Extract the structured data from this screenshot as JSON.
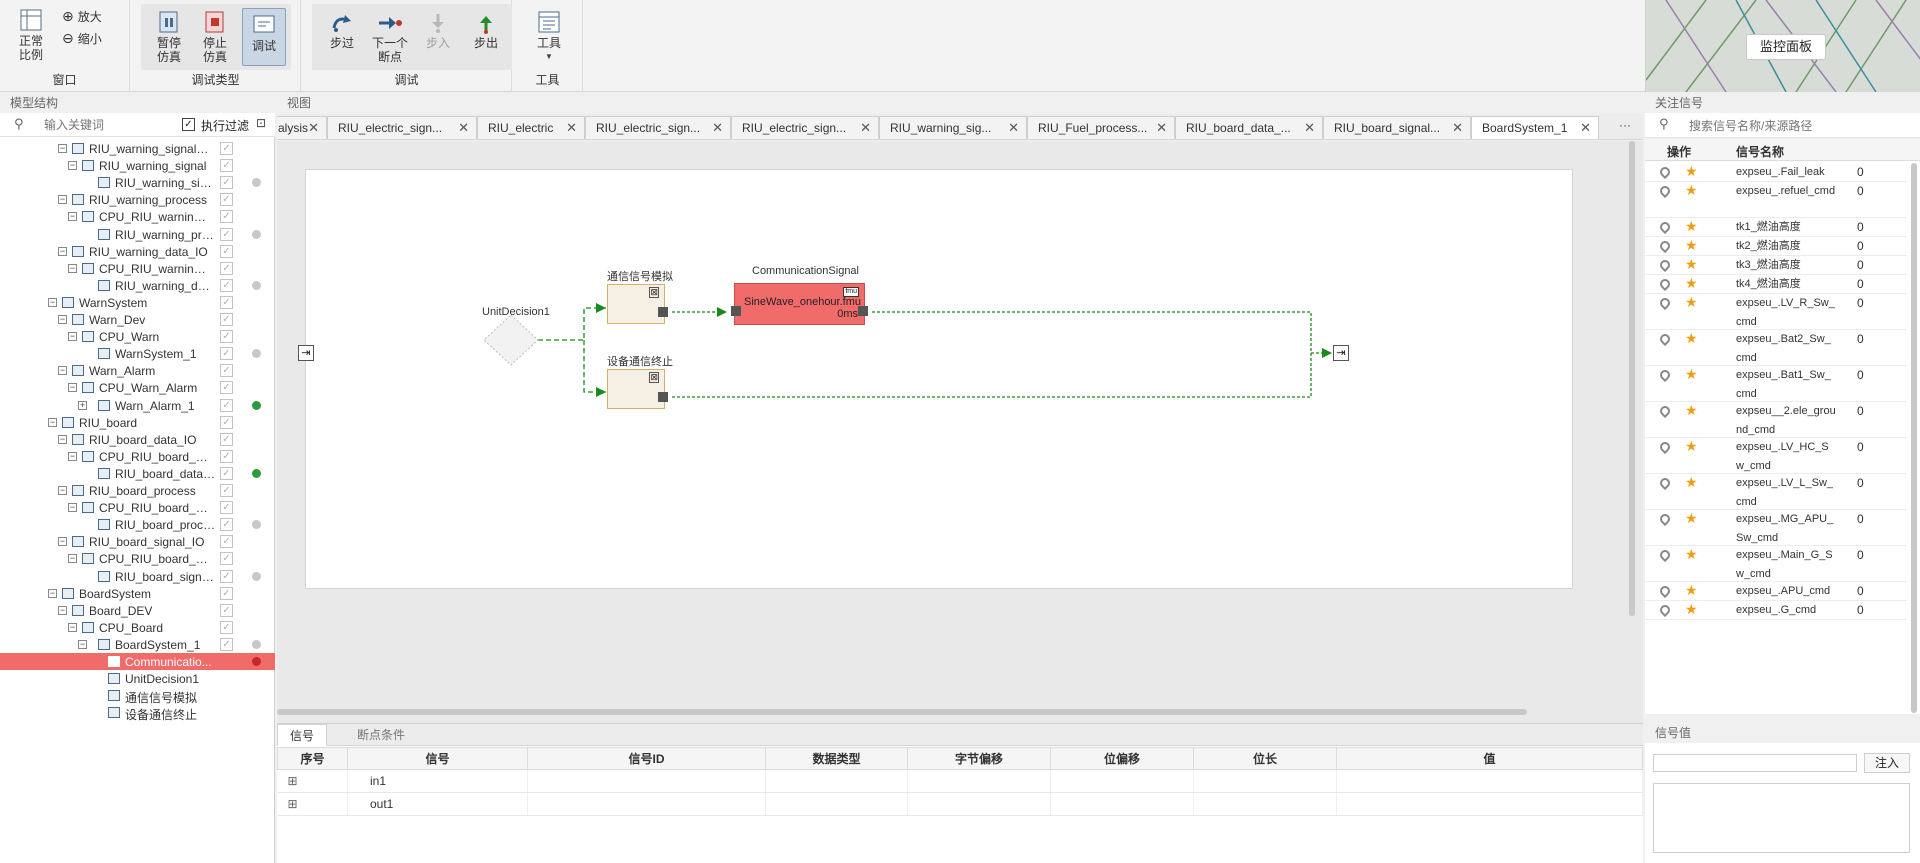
{
  "ribbon": {
    "window_group": {
      "label": "窗口",
      "normal_scale": "正常\n比例",
      "zoom_in": "放大",
      "zoom_out": "缩小"
    },
    "debug_type_group": {
      "label": "调试类型",
      "pause": "暂停\n仿真",
      "stop": "停止\n仿真",
      "debug": "调试"
    },
    "debug_group": {
      "label": "调试",
      "step_over": "步过",
      "next_breakpoint": "下一个\n断点",
      "step_into": "步入",
      "step_out": "步出"
    },
    "tools_group": {
      "label": "工具",
      "tools": "工具"
    }
  },
  "monitor": {
    "button": "监控面板"
  },
  "left_panel": {
    "title": "模型结构",
    "search_placeholder": "输入关键词",
    "filter_label": "执行过滤",
    "tree": [
      {
        "label": "RIU_warning_signal_IO",
        "level": 2,
        "expander": "⊟",
        "dot": ""
      },
      {
        "label": "RIU_warning_signal",
        "level": 3,
        "expander": "⊟",
        "dot": ""
      },
      {
        "label": "RIU_warning_sign...",
        "level": 4,
        "expander": "",
        "dot": "gray"
      },
      {
        "label": "RIU_warning_process",
        "level": 2,
        "expander": "⊟",
        "dot": ""
      },
      {
        "label": "CPU_RIU_warning_p...",
        "level": 3,
        "expander": "⊟",
        "dot": ""
      },
      {
        "label": "RIU_warning_proc...",
        "level": 4,
        "expander": "",
        "dot": "gray"
      },
      {
        "label": "RIU_warning_data_IO",
        "level": 2,
        "expander": "⊟",
        "dot": ""
      },
      {
        "label": "CPU_RIU_warning_d...",
        "level": 3,
        "expander": "⊟",
        "dot": ""
      },
      {
        "label": "RIU_warning_data...",
        "level": 4,
        "expander": "",
        "dot": "gray"
      },
      {
        "label": "WarnSystem",
        "level": 1,
        "expander": "⊟",
        "dot": ""
      },
      {
        "label": "Warn_Dev",
        "level": 2,
        "expander": "⊟",
        "dot": ""
      },
      {
        "label": "CPU_Warn",
        "level": 3,
        "expander": "⊟",
        "dot": ""
      },
      {
        "label": "WarnSystem_1",
        "level": 4,
        "expander": "",
        "dot": "gray"
      },
      {
        "label": "Warn_Alarm",
        "level": 2,
        "expander": "⊟",
        "dot": ""
      },
      {
        "label": "CPU_Warn_Alarm",
        "level": 3,
        "expander": "⊟",
        "dot": ""
      },
      {
        "label": "Warn_Alarm_1",
        "level": 4,
        "expander": "⊞",
        "dot": "green"
      },
      {
        "label": "RIU_board",
        "level": 1,
        "expander": "⊟",
        "dot": ""
      },
      {
        "label": "RIU_board_data_IO",
        "level": 2,
        "expander": "⊟",
        "dot": ""
      },
      {
        "label": "CPU_RIU_board_data",
        "level": 3,
        "expander": "⊟",
        "dot": ""
      },
      {
        "label": "RIU_board_data_I...",
        "level": 4,
        "expander": "",
        "dot": "green"
      },
      {
        "label": "RIU_board_process",
        "level": 2,
        "expander": "⊟",
        "dot": ""
      },
      {
        "label": "CPU_RIU_board_pro...",
        "level": 3,
        "expander": "⊟",
        "dot": ""
      },
      {
        "label": "RIU_board_proces...",
        "level": 4,
        "expander": "",
        "dot": "gray"
      },
      {
        "label": "RIU_board_signal_IO",
        "level": 2,
        "expander": "⊟",
        "dot": ""
      },
      {
        "label": "CPU_RIU_board_sig...",
        "level": 3,
        "expander": "⊟",
        "dot": ""
      },
      {
        "label": "RIU_board_signal...",
        "level": 4,
        "expander": "",
        "dot": "gray"
      },
      {
        "label": "BoardSystem",
        "level": 1,
        "expander": "⊟",
        "dot": ""
      },
      {
        "label": "Board_DEV",
        "level": 2,
        "expander": "⊟",
        "dot": ""
      },
      {
        "label": "CPU_Board",
        "level": 3,
        "expander": "⊟",
        "dot": ""
      },
      {
        "label": "BoardSystem_1",
        "level": 4,
        "expander": "⊟",
        "dot": "gray"
      },
      {
        "label": "Communicatio...",
        "level": 5,
        "expander": "",
        "dot": "red",
        "selected": true
      },
      {
        "label": "UnitDecision1",
        "level": 5,
        "expander": "",
        "dot": ""
      },
      {
        "label": "通信信号模拟",
        "level": 5,
        "expander": "",
        "dot": ""
      },
      {
        "label": "设备通信终止",
        "level": 5,
        "expander": "",
        "dot": ""
      }
    ]
  },
  "view": {
    "title": "视图",
    "tabs": [
      {
        "label": "alysis"
      },
      {
        "label": "RIU_electric_sign..."
      },
      {
        "label": "RIU_electric"
      },
      {
        "label": "RIU_electric_sign..."
      },
      {
        "label": "RIU_electric_sign..."
      },
      {
        "label": "RIU_warning_sig..."
      },
      {
        "label": "RIU_Fuel_process..."
      },
      {
        "label": "RIU_board_data_..."
      },
      {
        "label": "RIU_board_signal..."
      },
      {
        "label": "BoardSystem_1",
        "active": true
      }
    ],
    "more": "···",
    "diagram": {
      "decision_label": "UnitDecision1",
      "sim_label": "通信信号模拟",
      "term_label": "设备通信终止",
      "comm_label": "CommunicationSignal",
      "fmu_name": "SineWave_onehour.fmu",
      "fmu_time": "0ms",
      "fmu_badge": "fmu"
    }
  },
  "bottom": {
    "tabs": [
      "信号",
      "断点条件"
    ],
    "columns": [
      "序号",
      "信号",
      "信号ID",
      "数据类型",
      "字节偏移",
      "位偏移",
      "位长",
      "值"
    ],
    "rows": [
      {
        "seq": "⊞",
        "signal": "in1"
      },
      {
        "seq": "⊞",
        "signal": "out1"
      }
    ]
  },
  "right_panel": {
    "title": "关注信号",
    "search_placeholder": "搜索信号名称/来源路径",
    "columns": [
      "操作",
      "信号名称"
    ],
    "rows": [
      {
        "name": "expseu_.Fail_leak",
        "value": "0",
        "lines": 1
      },
      {
        "name": "expseu_.refuel_cmd",
        "value": "0",
        "lines": 2
      },
      {
        "name": "tk1_燃油高度",
        "value": "0",
        "lines": 1
      },
      {
        "name": "tk2_燃油高度",
        "value": "0",
        "lines": 1
      },
      {
        "name": "tk3_燃油高度",
        "value": "0",
        "lines": 1
      },
      {
        "name": "tk4_燃油高度",
        "value": "0",
        "lines": 1
      },
      {
        "name": "expseu_.LV_R_Sw_cmd",
        "value": "0",
        "lines": 2
      },
      {
        "name": "expseu_.Bat2_Sw_cmd",
        "value": "0",
        "lines": 2
      },
      {
        "name": "expseu_.Bat1_Sw_cmd",
        "value": "0",
        "lines": 2
      },
      {
        "name": "expseu__2.ele_ground_cmd",
        "value": "0",
        "lines": 2
      },
      {
        "name": "expseu_.LV_HC_Sw_cmd",
        "value": "0",
        "lines": 2
      },
      {
        "name": "expseu_.LV_L_Sw_cmd",
        "value": "0",
        "lines": 2
      },
      {
        "name": "expseu_.MG_APU_Sw_cmd",
        "value": "0",
        "lines": 2
      },
      {
        "name": "expseu_.Main_G_Sw_cmd",
        "value": "0",
        "lines": 2
      },
      {
        "name": "expseu_.APU_cmd",
        "value": "0",
        "lines": 1
      },
      {
        "name": "expseu_.G_cmd",
        "value": "0",
        "lines": 1
      }
    ]
  },
  "signal_value": {
    "title": "信号值",
    "inject": "注入"
  },
  "colors": {
    "selected": "#f26b6b",
    "fmu_fill": "#f26b6b",
    "flow": "#1a8a1a",
    "star": "#f39c12"
  }
}
